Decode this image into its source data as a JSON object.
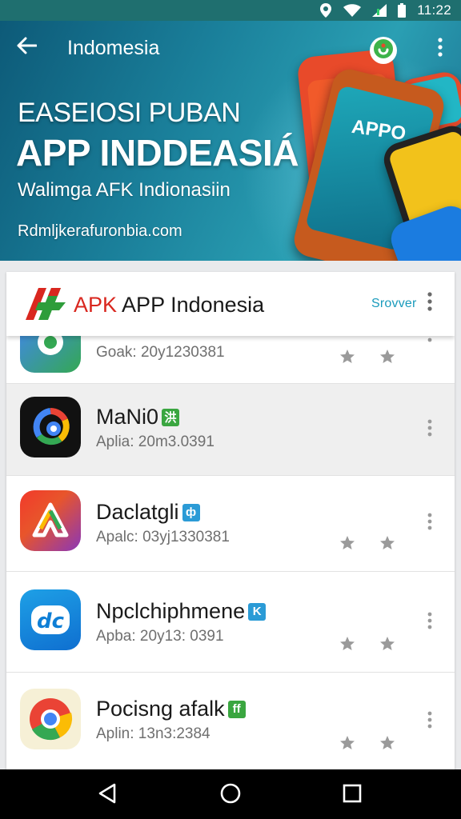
{
  "status_bar": {
    "time": "11:22",
    "icons": [
      "location-icon",
      "wifi-icon",
      "signal-icon",
      "battery-icon"
    ]
  },
  "app_bar": {
    "title": "Indomesia",
    "back_icon": "arrow-left-icon",
    "more_icon": "more-vertical-icon"
  },
  "hero": {
    "line1": "EASEIOSI PUBAN",
    "line2": "APP INDDEASIÁ",
    "line3": "Walimga AFK Indionasiin",
    "url": "Rdmljkerafuronbia.com",
    "phone_text": "APPO"
  },
  "card_header": {
    "brand_prefix": "APK",
    "brand_rest": "APP Indonesia",
    "action_label": "Srovver",
    "more_icon": "more-vertical-icon"
  },
  "apps": [
    {
      "name": "",
      "meta": "Goak: 20y1230381",
      "tag": "",
      "tag_color": "",
      "icon": "maps-app-icon",
      "selected": false
    },
    {
      "name": "MaNi0",
      "meta": "Aplia: 20m3.0391",
      "tag": "洪",
      "tag_color": "#3aa640",
      "icon": "google-app-icon",
      "selected": true
    },
    {
      "name": "Daclatgli",
      "meta": "Apalc: 03yj1330381",
      "tag": "ф",
      "tag_color": "#2b9bd6",
      "icon": "drive-app-icon",
      "selected": false
    },
    {
      "name": "Npclchiphmene",
      "meta": "Apba: 20y13: 0391",
      "tag": "K",
      "tag_color": "#2b9bd6",
      "icon": "dc-app-icon",
      "selected": false
    },
    {
      "name": "Pocisng afalk",
      "meta": "Aplin: 13n3:2384",
      "tag": "ff",
      "tag_color": "#3aa640",
      "icon": "chrome-app-icon",
      "selected": false
    }
  ],
  "nav_bar": {
    "back_icon": "nav-back-icon",
    "home_icon": "nav-home-icon",
    "recents_icon": "nav-recents-icon"
  },
  "colors": {
    "status_bar": "#1f6f6f",
    "hero_start": "#0d5a78",
    "hero_end": "#2a9fb3",
    "accent": "#1a9bbc",
    "brand_red": "#d9271f"
  }
}
